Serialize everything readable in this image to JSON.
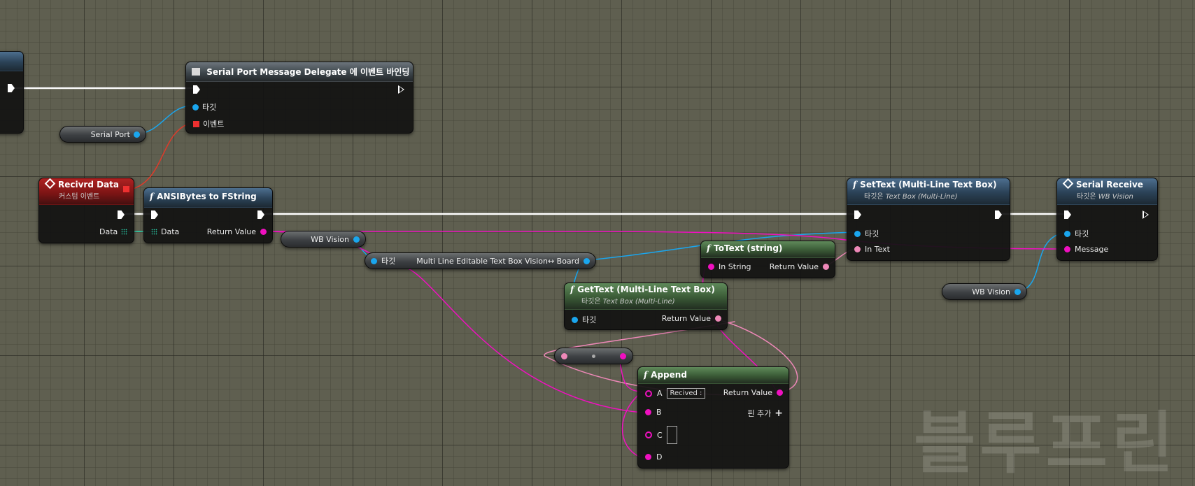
{
  "watermark": "블루프린",
  "nodes": {
    "bind": {
      "title": "Serial Port Message Delegate 에 이벤트 바인딩",
      "pin_target": "타깃",
      "pin_event": "이벤트"
    },
    "recv": {
      "title": "Recivrd Data",
      "subtitle": "커스텀 이벤트",
      "pin_data": "Data"
    },
    "ansi": {
      "title": "ANSIBytes to FString",
      "pin_data": "Data",
      "pin_return": "Return Value"
    },
    "settext": {
      "title": "SetText (Multi-Line Text Box)",
      "subtitle_prefix": "타깃은",
      "subtitle_target": "Text Box (Multi-Line)",
      "pin_target": "타깃",
      "pin_intext": "In Text"
    },
    "serialrecv": {
      "title": "Serial Receive",
      "subtitle_prefix": "타깃은",
      "subtitle_target": "WB Vision",
      "pin_target": "타깃",
      "pin_message": "Message"
    },
    "totext": {
      "title": "ToText (string)",
      "pin_in": "In String",
      "pin_return": "Return Value"
    },
    "gettext": {
      "title": "GetText (Multi-Line Text Box)",
      "subtitle_prefix": "타깃은",
      "subtitle_target": "Text Box (Multi-Line)",
      "pin_target": "타깃",
      "pin_return": "Return Value"
    },
    "append": {
      "title": "Append",
      "pin_a": "A",
      "pin_a_value": "Recived :",
      "pin_b": "B",
      "pin_c": "C",
      "pin_d": "D",
      "pin_return": "Return Value",
      "add_pin": "핀 추가"
    }
  },
  "vars": {
    "serial_port": "Serial Port",
    "wb_vision_1": "WB Vision",
    "wb_vision_2": "WB Vision",
    "textbox_target": "타깃",
    "textbox_name": "Multi Line Editable Text Box Vision↔ Board"
  },
  "colors": {
    "exec_wire": "#ffffff",
    "object_wire": "#1aa6ee",
    "string_wire": "#f010c0",
    "text_wire": "#ee88b8",
    "delegate_wire": "#e03a2a",
    "byte_array_wire": "#2ad6b0"
  }
}
